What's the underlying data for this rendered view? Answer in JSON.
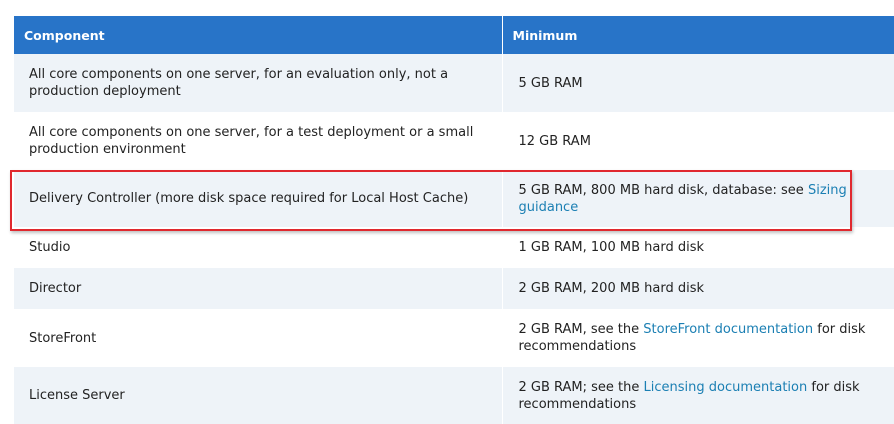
{
  "table": {
    "headers": [
      "Component",
      "Minimum"
    ],
    "rows": [
      {
        "component": "All core components on one server, for an evaluation only, not a production deployment",
        "minimum_pre": "5 GB RAM"
      },
      {
        "component": "All core components on one server, for a test deployment or a small production environment",
        "minimum_pre": "12 GB RAM"
      },
      {
        "component": "Delivery Controller (more disk space required for Local Host Cache)",
        "minimum_pre": "5 GB RAM, 800 MB hard disk, database: see ",
        "link": "Sizing guidance",
        "minimum_post": ""
      },
      {
        "component": "Studio",
        "minimum_pre": "1 GB RAM, 100 MB hard disk"
      },
      {
        "component": "Director",
        "minimum_pre": "2 GB RAM, 200 MB hard disk"
      },
      {
        "component": "StoreFront",
        "minimum_pre": "2 GB RAM, see the ",
        "link": "StoreFront documentation",
        "minimum_post": " for disk recommendations"
      },
      {
        "component": "License Server",
        "minimum_pre": "2 GB RAM; see the ",
        "link": "Licensing documentation",
        "minimum_post": " for disk recommendations"
      }
    ]
  },
  "colors": {
    "header_bg": "#2874c8",
    "row_alt_bg": "#eef3f8",
    "link": "#1b7fb3",
    "highlight_border": "#e0282e"
  }
}
